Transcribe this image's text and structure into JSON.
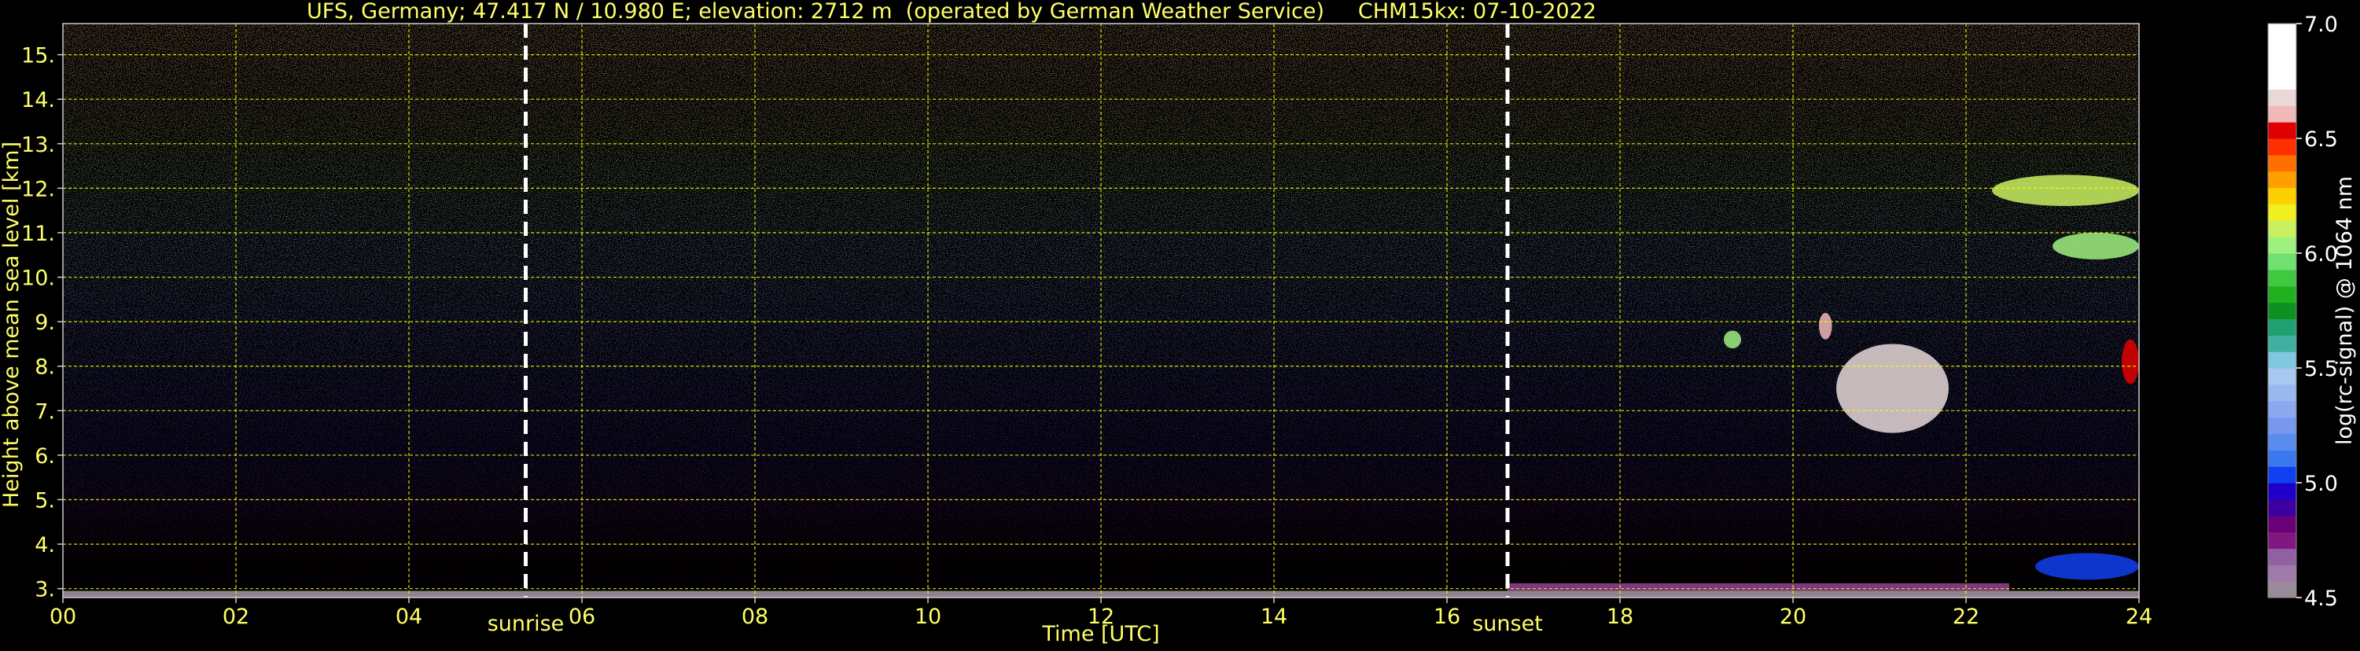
{
  "chart_data": {
    "type": "heatmap",
    "title": "UFS, Germany; 47.417 N / 10.980 E; elevation: 2712 m  (operated by German Weather Service)     CHM15kx: 07-10-2022",
    "xlabel": "Time [UTC]",
    "ylabel": "Height above mean sea level [km]",
    "xlim": [
      0,
      24
    ],
    "ylim": [
      2.8,
      15.7
    ],
    "x_ticks": [
      "00",
      "02",
      "04",
      "06",
      "08",
      "10",
      "12",
      "14",
      "16",
      "18",
      "20",
      "22",
      "24"
    ],
    "y_ticks": [
      "3.",
      "4.",
      "5.",
      "6.",
      "7.",
      "8.",
      "9.",
      "10.",
      "11.",
      "12.",
      "13.",
      "14.",
      "15."
    ],
    "grid": true,
    "events": [
      {
        "label": "sunrise",
        "x": 5.35
      },
      {
        "label": "sunset",
        "x": 16.7
      }
    ],
    "features": [
      {
        "t0": 20.5,
        "t1": 21.8,
        "h0": 6.5,
        "h1": 8.5,
        "value": 6.7
      },
      {
        "t0": 19.2,
        "t1": 19.4,
        "h0": 8.4,
        "h1": 8.8,
        "value": 6.0
      },
      {
        "t0": 20.3,
        "t1": 20.45,
        "h0": 8.6,
        "h1": 9.2,
        "value": 6.6
      },
      {
        "t0": 22.3,
        "t1": 24.0,
        "h0": 11.6,
        "h1": 12.3,
        "value": 6.1
      },
      {
        "t0": 23.0,
        "t1": 24.0,
        "h0": 10.4,
        "h1": 11.0,
        "value": 6.0
      },
      {
        "t0": 23.8,
        "t1": 24.0,
        "h0": 7.6,
        "h1": 8.6,
        "value": 6.5
      },
      {
        "t0": 22.8,
        "t1": 24.0,
        "h0": 3.2,
        "h1": 3.8,
        "value": 5.0
      }
    ],
    "colorbar": {
      "label": "log(rc-signal) @ 1064 nm",
      "min": 4.5,
      "max": 7.0,
      "ticks": [
        "7.0",
        "6.5",
        "6.0",
        "5.5",
        "5.0",
        "4.5"
      ],
      "colors": [
        "#9a8a9a",
        "#a07aa8",
        "#9060a0",
        "#801880",
        "#6a0078",
        "#3c00a0",
        "#2000c8",
        "#1040f0",
        "#3a78f0",
        "#5a8cf0",
        "#7898f0",
        "#8ca8f0",
        "#9ab8f0",
        "#a8c8f0",
        "#7fc8e0",
        "#40b0a0",
        "#20a070",
        "#109020",
        "#20b020",
        "#40c840",
        "#70e070",
        "#a0f080",
        "#c8f060",
        "#f0f020",
        "#ffd000",
        "#ffa000",
        "#ff7000",
        "#ff3000",
        "#e00000",
        "#f0b8b8",
        "#e8d8d8",
        "#ffffff",
        "#ffffff",
        "#ffffff",
        "#ffffff"
      ]
    }
  },
  "colors": {
    "text": "#ffff66",
    "colorbar_text": "#ffffff",
    "grid": "#ffff00",
    "background": "#000000"
  }
}
